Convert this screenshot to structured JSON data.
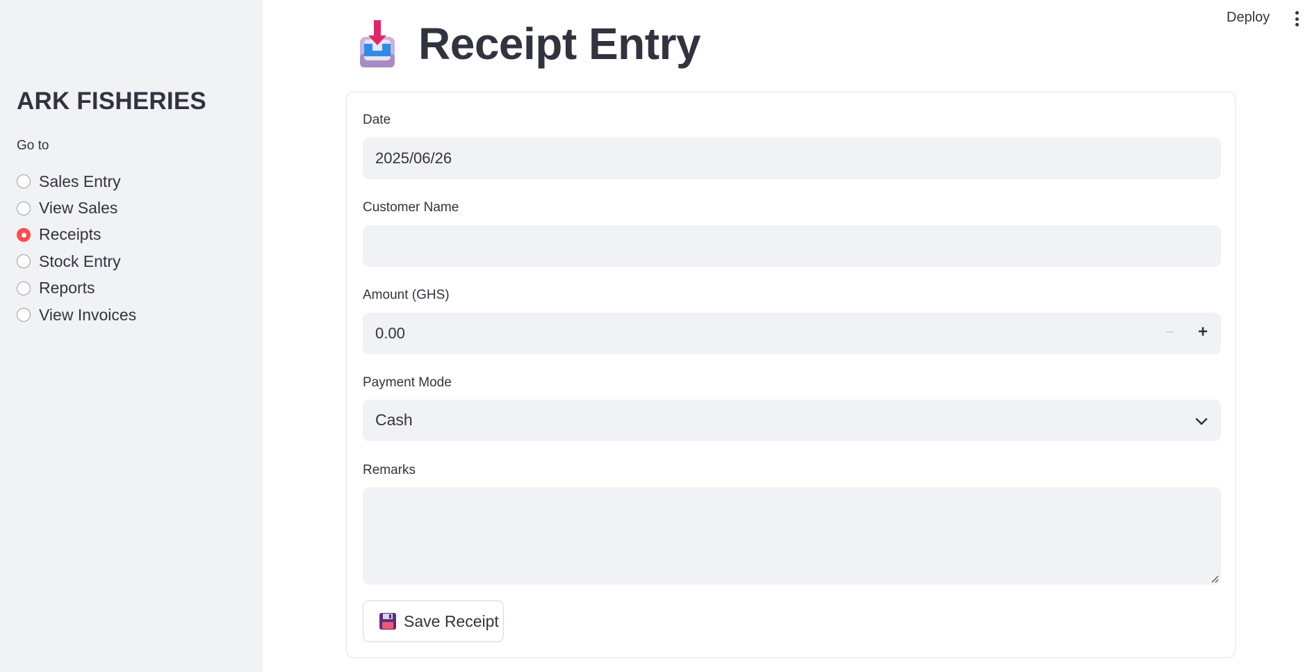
{
  "header": {
    "deploy_label": "Deploy",
    "menu_icon": "kebab-vertical-icon"
  },
  "sidebar": {
    "brand": "ARK FISHERIES",
    "nav_heading": "Go to",
    "items": [
      {
        "label": "Sales Entry",
        "selected": false
      },
      {
        "label": "View Sales",
        "selected": false
      },
      {
        "label": "Receipts",
        "selected": true
      },
      {
        "label": "Stock Entry",
        "selected": false
      },
      {
        "label": "Reports",
        "selected": false
      },
      {
        "label": "View Invoices",
        "selected": false
      }
    ]
  },
  "page": {
    "title": "Receipt Entry",
    "title_icon": "inbox-tray-icon"
  },
  "form": {
    "date": {
      "label": "Date",
      "value": "2025/06/26"
    },
    "customer_name": {
      "label": "Customer Name",
      "value": ""
    },
    "amount": {
      "label": "Amount (GHS)",
      "value": "0.00",
      "minus": "−",
      "plus": "+"
    },
    "payment_mode": {
      "label": "Payment Mode",
      "value": "Cash"
    },
    "remarks": {
      "label": "Remarks",
      "value": ""
    },
    "save_button": {
      "label": "Save Receipt",
      "icon": "floppy-disk-icon"
    }
  },
  "colors": {
    "accent": "#ff4b4b",
    "sidebar_bg": "#f0f2f6",
    "text": "#31333f",
    "input_bg": "#f0f2f6"
  }
}
